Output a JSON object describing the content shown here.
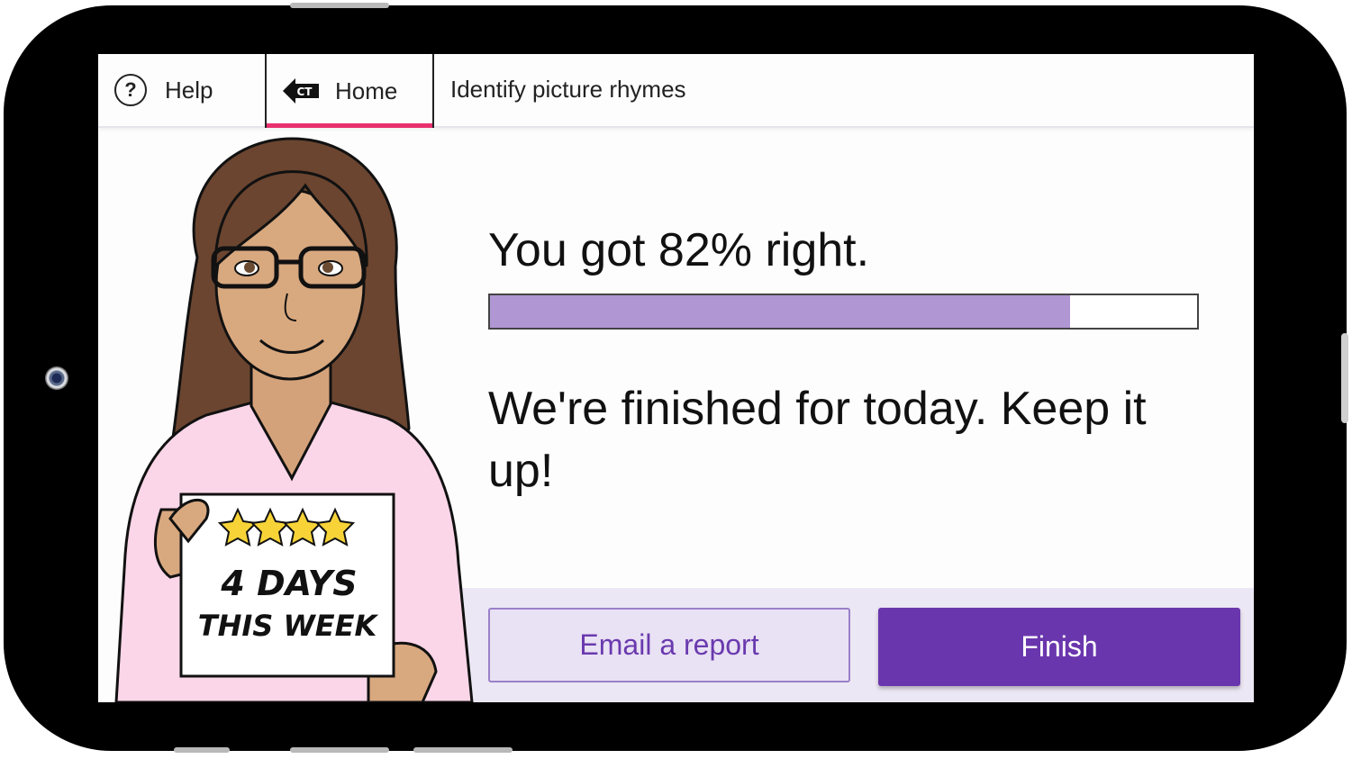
{
  "topbar": {
    "help_label": "Help",
    "help_icon": "?",
    "home_label": "Home",
    "home_icon_text": "CT",
    "activity_title": "Identify picture rhymes"
  },
  "result": {
    "score_text": "You got 82% right.",
    "score_fraction": 0.82,
    "message": "We're finished for today. Keep it up!"
  },
  "sign": {
    "stars": 4,
    "line1": "4 DAYS",
    "line2": "THIS WEEK"
  },
  "actions": {
    "email_label": "Email a report",
    "finish_label": "Finish"
  },
  "colors": {
    "accent": "#6a36ad",
    "progress_fill": "#b097d3",
    "home_underline": "#e8306f",
    "email_button_bg": "#e9e1f4"
  }
}
